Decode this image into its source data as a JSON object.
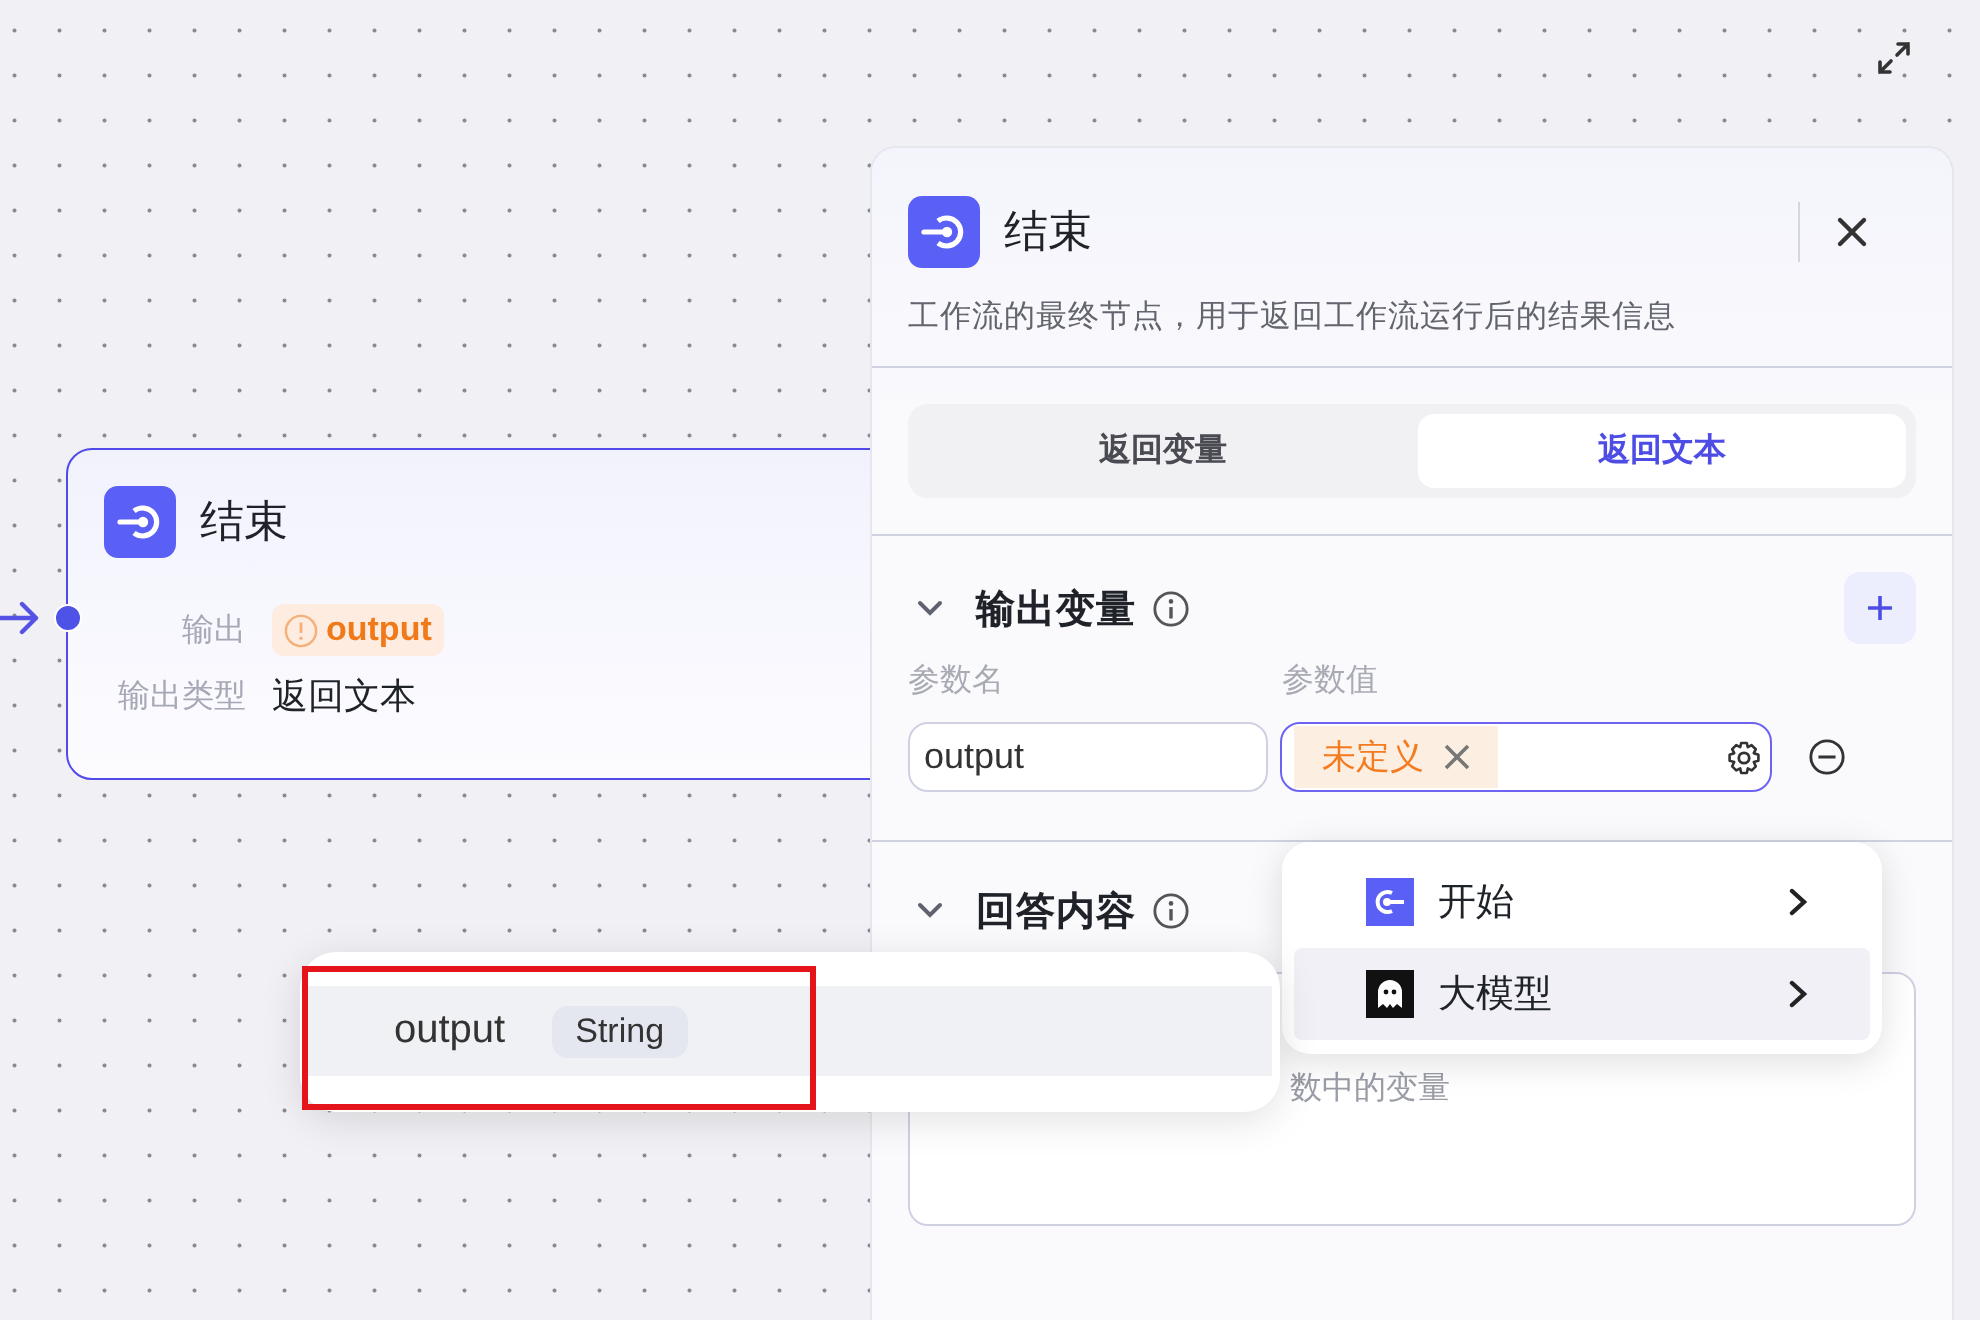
{
  "node": {
    "title": "结束",
    "rows": [
      {
        "label": "输出",
        "kind": "tag",
        "value": "output",
        "warning": true
      },
      {
        "label": "输出类型",
        "kind": "text",
        "value": "返回文本"
      }
    ]
  },
  "panel": {
    "title": "结束",
    "description": "工作流的最终节点，用于返回工作流运行后的结果信息",
    "tabs": [
      {
        "label": "返回变量",
        "selected": false
      },
      {
        "label": "返回文本",
        "selected": true
      }
    ],
    "output_section": {
      "title": "输出变量",
      "expanded": true,
      "columns": [
        "参数名",
        "参数值"
      ],
      "params": [
        {
          "name": "output",
          "value": "未定义"
        }
      ]
    },
    "answer_section": {
      "title": "回答内容",
      "expanded": true,
      "placeholder": "数中的变量"
    }
  },
  "source_menu": {
    "items": [
      {
        "label": "开始",
        "kind": "start",
        "selected": false
      },
      {
        "label": "大模型",
        "kind": "llm",
        "selected": true
      }
    ]
  },
  "variable_menu": {
    "items": [
      {
        "name": "output",
        "type": "String",
        "selected": true
      }
    ]
  }
}
